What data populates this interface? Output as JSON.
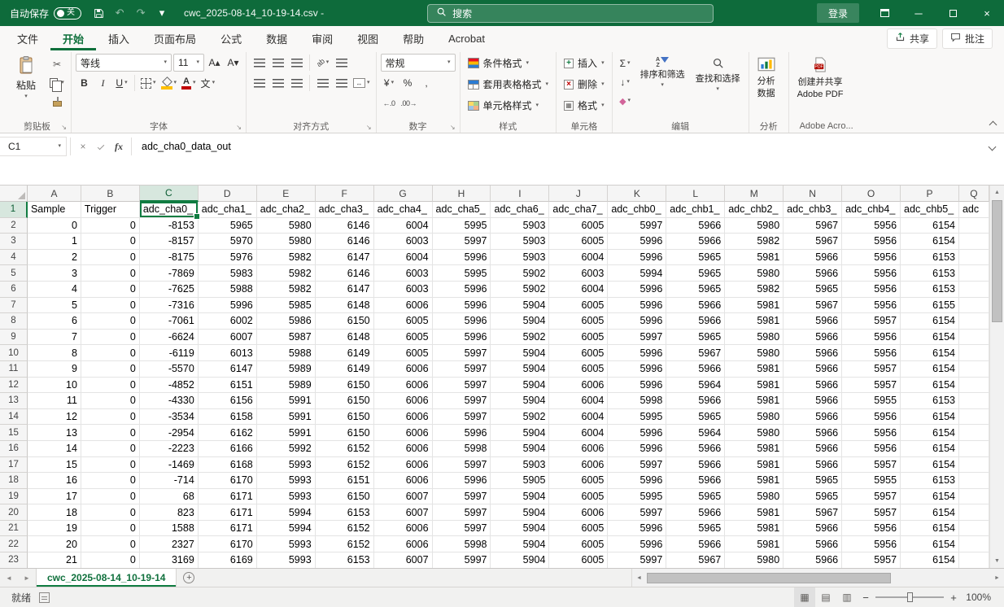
{
  "colors": {
    "excel_green": "#107C41",
    "titlebar_green": "#0E6B3B"
  },
  "titlebar": {
    "autosave_label": "自动保存",
    "autosave_state": "关",
    "filename": "cwc_2025-08-14_10-19-14.csv -",
    "search_placeholder": "搜索",
    "signin_label": "登录"
  },
  "ribbon": {
    "tabs": [
      "文件",
      "开始",
      "插入",
      "页面布局",
      "公式",
      "数据",
      "审阅",
      "视图",
      "帮助",
      "Acrobat"
    ],
    "active_tab": "开始",
    "share_label": "共享",
    "comments_label": "批注",
    "clipboard": {
      "group_label": "剪贴板",
      "paste_label": "粘贴"
    },
    "font": {
      "group_label": "字体",
      "font_name": "等线",
      "font_size": "11"
    },
    "alignment": {
      "group_label": "对齐方式"
    },
    "number": {
      "group_label": "数字",
      "format": "常规"
    },
    "styles": {
      "group_label": "样式",
      "conditional_label": "条件格式",
      "format_table_label": "套用表格格式",
      "cell_styles_label": "单元格样式"
    },
    "cells": {
      "group_label": "单元格",
      "insert_label": "插入",
      "delete_label": "删除",
      "format_label": "格式"
    },
    "editing": {
      "group_label": "编辑",
      "sort_label": "排序和筛选",
      "find_label": "查找和选择"
    },
    "analysis": {
      "group_label": "分析",
      "analyze_label_1": "分析",
      "analyze_label_2": "数据"
    },
    "acrobat": {
      "group_label": "Adobe Acro...",
      "button_label_1": "创建并共享",
      "button_label_2": "Adobe PDF"
    }
  },
  "icons": {
    "dropdown": "▾",
    "cut": "✂",
    "bold": "B",
    "italic": "I",
    "underline": "U",
    "increase_font": "A▴",
    "decrease_font": "A▾",
    "phonetic": "文",
    "accounting": "¥",
    "percent": "%",
    "comma": ",",
    "inc_decimal": "←.0",
    "dec_decimal": ".00→",
    "sum": "Σ",
    "fill_down": "↓",
    "clear": "◆",
    "merge_arrows": "↔",
    "orientation": "ab",
    "undo": "↶",
    "redo": "↷",
    "close": "×",
    "cancel": "×",
    "fx": "fx",
    "scroll_up": "▲",
    "scroll_down": "▼",
    "scroll_left": "◄",
    "scroll_right": "►",
    "normal_view": "▦",
    "page_layout_view": "▤",
    "page_break_view": "▥",
    "zoom_out": "−",
    "zoom_in": "+",
    "add_sheet": "+",
    "launcher": "↘"
  },
  "formula_bar": {
    "name_box": "C1",
    "formula": "adc_cha0_data_out"
  },
  "sheet": {
    "columns": [
      "A",
      "B",
      "C",
      "D",
      "E",
      "F",
      "G",
      "H",
      "I",
      "J",
      "K",
      "L",
      "M",
      "N",
      "O",
      "P",
      "Q"
    ],
    "selected": {
      "col": "C",
      "row": 1
    },
    "header_row": [
      "Sample",
      "Trigger",
      "adc_cha0_",
      "adc_cha1_",
      "adc_cha2_",
      "adc_cha3_",
      "adc_cha4_",
      "adc_cha5_",
      "adc_cha6_",
      "adc_cha7_",
      "adc_chb0_",
      "adc_chb1_",
      "adc_chb2_",
      "adc_chb3_",
      "adc_chb4_",
      "adc_chb5_",
      "adc"
    ],
    "data_rows": [
      [
        0,
        0,
        -8153,
        5965,
        5980,
        6146,
        6004,
        5995,
        5903,
        6005,
        5997,
        5966,
        5980,
        5967,
        5956,
        6154
      ],
      [
        1,
        0,
        -8157,
        5970,
        5980,
        6146,
        6003,
        5997,
        5903,
        6005,
        5996,
        5966,
        5982,
        5967,
        5956,
        6154
      ],
      [
        2,
        0,
        -8175,
        5976,
        5982,
        6147,
        6004,
        5996,
        5903,
        6004,
        5996,
        5965,
        5981,
        5966,
        5956,
        6153
      ],
      [
        3,
        0,
        -7869,
        5983,
        5982,
        6146,
        6003,
        5995,
        5902,
        6003,
        5994,
        5965,
        5980,
        5966,
        5956,
        6153
      ],
      [
        4,
        0,
        -7625,
        5988,
        5982,
        6147,
        6003,
        5996,
        5902,
        6004,
        5996,
        5965,
        5982,
        5965,
        5956,
        6153
      ],
      [
        5,
        0,
        -7316,
        5996,
        5985,
        6148,
        6006,
        5996,
        5904,
        6005,
        5996,
        5966,
        5981,
        5967,
        5956,
        6155
      ],
      [
        6,
        0,
        -7061,
        6002,
        5986,
        6150,
        6005,
        5996,
        5904,
        6005,
        5996,
        5966,
        5981,
        5966,
        5957,
        6154
      ],
      [
        7,
        0,
        -6624,
        6007,
        5987,
        6148,
        6005,
        5996,
        5902,
        6005,
        5997,
        5965,
        5980,
        5966,
        5956,
        6154
      ],
      [
        8,
        0,
        -6119,
        6013,
        5988,
        6149,
        6005,
        5997,
        5904,
        6005,
        5996,
        5967,
        5980,
        5966,
        5956,
        6154
      ],
      [
        9,
        0,
        -5570,
        6147,
        5989,
        6149,
        6006,
        5997,
        5904,
        6005,
        5996,
        5966,
        5981,
        5966,
        5957,
        6154
      ],
      [
        10,
        0,
        -4852,
        6151,
        5989,
        6150,
        6006,
        5997,
        5904,
        6006,
        5996,
        5964,
        5981,
        5966,
        5957,
        6154
      ],
      [
        11,
        0,
        -4330,
        6156,
        5991,
        6150,
        6006,
        5997,
        5904,
        6004,
        5998,
        5966,
        5981,
        5966,
        5955,
        6153
      ],
      [
        12,
        0,
        -3534,
        6158,
        5991,
        6150,
        6006,
        5997,
        5902,
        6004,
        5995,
        5965,
        5980,
        5966,
        5956,
        6154
      ],
      [
        13,
        0,
        -2954,
        6162,
        5991,
        6150,
        6006,
        5996,
        5904,
        6004,
        5996,
        5964,
        5980,
        5966,
        5956,
        6154
      ],
      [
        14,
        0,
        -2223,
        6166,
        5992,
        6152,
        6006,
        5998,
        5904,
        6006,
        5996,
        5966,
        5981,
        5966,
        5956,
        6154
      ],
      [
        15,
        0,
        -1469,
        6168,
        5993,
        6152,
        6006,
        5997,
        5903,
        6006,
        5997,
        5966,
        5981,
        5966,
        5957,
        6154
      ],
      [
        16,
        0,
        -714,
        6170,
        5993,
        6151,
        6006,
        5996,
        5905,
        6005,
        5996,
        5966,
        5981,
        5965,
        5955,
        6153
      ],
      [
        17,
        0,
        68,
        6171,
        5993,
        6150,
        6007,
        5997,
        5904,
        6005,
        5995,
        5965,
        5980,
        5965,
        5957,
        6154
      ],
      [
        18,
        0,
        823,
        6171,
        5994,
        6153,
        6007,
        5997,
        5904,
        6006,
        5997,
        5966,
        5981,
        5967,
        5957,
        6154
      ],
      [
        19,
        0,
        1588,
        6171,
        5994,
        6152,
        6006,
        5997,
        5904,
        6005,
        5996,
        5965,
        5981,
        5966,
        5956,
        6154
      ],
      [
        20,
        0,
        2327,
        6170,
        5993,
        6152,
        6006,
        5998,
        5904,
        6005,
        5996,
        5966,
        5981,
        5966,
        5956,
        6154
      ],
      [
        21,
        0,
        3169,
        6169,
        5993,
        6153,
        6007,
        5997,
        5904,
        6005,
        5997,
        5967,
        5980,
        5966,
        5957,
        6154
      ]
    ]
  },
  "sheet_bar": {
    "sheet_name": "cwc_2025-08-14_10-19-14"
  },
  "status_bar": {
    "ready_label": "就绪",
    "zoom_level": "100%"
  }
}
